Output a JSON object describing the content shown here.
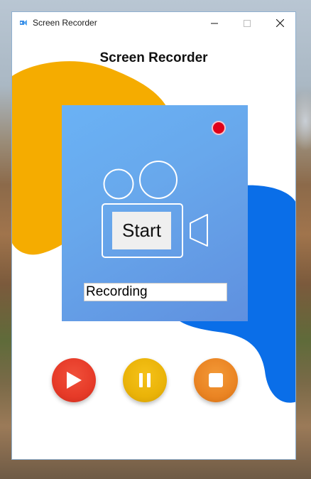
{
  "window": {
    "title": "Screen Recorder",
    "controls": [
      "minimize",
      "maximize",
      "close"
    ]
  },
  "app": {
    "header": "Screen Recorder",
    "start_label": "Start",
    "status_value": "Recording",
    "record_indicator_color": "#e0001a",
    "panel_color": "#68a8ec",
    "controls": {
      "play": {
        "color": "#e63a28",
        "icon": "play-icon"
      },
      "pause": {
        "color": "#eab308",
        "icon": "pause-icon"
      },
      "stop": {
        "color": "#ea8423",
        "icon": "stop-icon"
      }
    }
  },
  "decor": {
    "blob_colors": [
      "#f5ac00",
      "#0a6ee8"
    ]
  }
}
